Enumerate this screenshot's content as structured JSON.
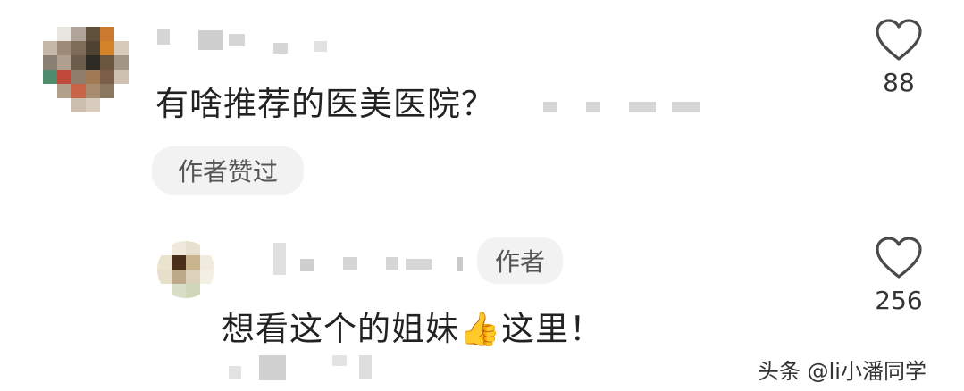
{
  "comment": {
    "text": "有啥推荐的医美医院？",
    "author_badge": "作者赞过",
    "like_icon": "heart-outline-icon",
    "like_count": "88"
  },
  "reply": {
    "author_tag": "作者",
    "text_before": "想看这个的姐妹",
    "emoji": "👍",
    "text_after": "这里！",
    "like_icon": "heart-outline-icon",
    "like_count": "256"
  },
  "watermark": "头条 @li小潘同学",
  "colors": {
    "heart_stroke": "#4a4a4a",
    "pill_bg": "#f2f2f2",
    "mosaic_blur": "#d6d6d6"
  }
}
